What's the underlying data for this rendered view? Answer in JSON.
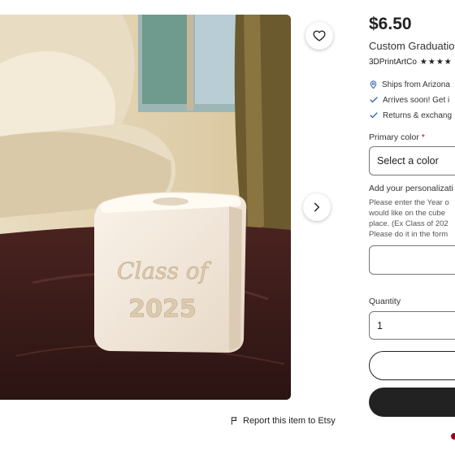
{
  "listing": {
    "price": "$6.50",
    "title": "Custom Graduatio",
    "shop_name": "3DPrintArtCo",
    "stars": "★★★★",
    "ships_from": "Ships from Arizona",
    "arrives": "Arrives soon! Get i",
    "returns": "Returns & exchang"
  },
  "photo": {
    "engraving_line1": "Class of",
    "engraving_line2": "2025"
  },
  "options": {
    "primary_color_label": "Primary color",
    "required_mark": "*",
    "select_value": "Select a color",
    "personalization_label": "Add your personalizati",
    "personalization_help": [
      "Please enter the Year o",
      "would like on the cube",
      "place. (Ex Class of 202",
      "Please do it in the form"
    ],
    "personalization_value": "",
    "quantity_label": "Quantity",
    "quantity_value": "1"
  },
  "footer": {
    "report_link": "Report this item to Etsy"
  },
  "colors": {
    "accent": "#222222",
    "required": "#b00020",
    "link_icon": "#2e5ea8"
  },
  "icons": [
    "heart-icon",
    "chevron-right-icon",
    "flag-icon",
    "location-pin-icon",
    "check-icon"
  ]
}
